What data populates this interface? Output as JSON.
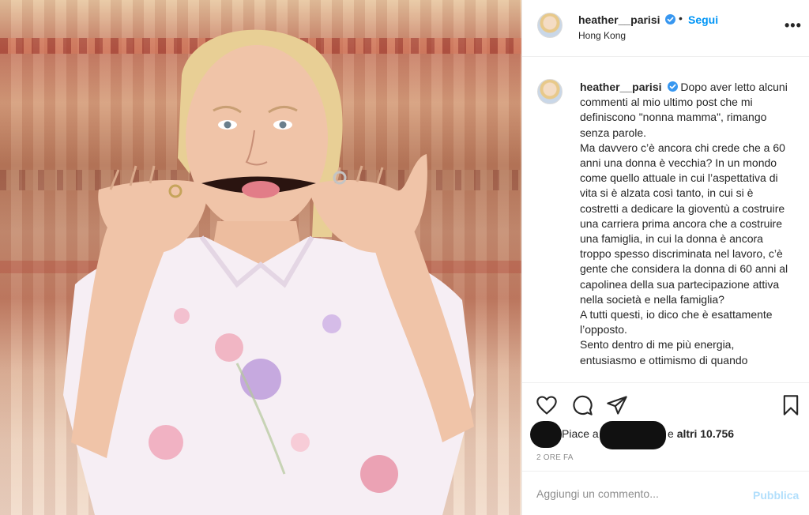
{
  "post": {
    "username": "heather__parisi",
    "verified": true,
    "follow_label": "Segui",
    "separator": "•",
    "location": "Hong Kong",
    "more_icon": "more-options-icon",
    "photo_icon": "post-photo"
  },
  "caption": {
    "username": "heather__parisi",
    "paragraphs": [
      "Dopo aver letto alcuni commenti al mio ultimo post che mi definiscono \"nonna mamma\", rimango senza parole.",
      "Ma davvero c’è ancora chi crede che a 60 anni una donna è vecchia? In un mondo come quello attuale in cui l’aspettativa di vita si è alzata così tanto, in cui si è costretti a dedicare la gioventù a costruire una carriera prima ancora che a costruire una famiglia, in cui la donna è ancora troppo spesso discriminata nel lavoro, c’è gente che considera la donna di 60 anni al capolinea della sua partecipazione attiva nella società e nella famiglia?",
      "A tutti questi, io dico che è esattamente l’opposto.",
      "Sento dentro di me più energia, entusiasmo e ottimismo di quando"
    ]
  },
  "actions": {
    "icons": [
      "heart-icon",
      "comment-icon",
      "share-icon",
      "bookmark-icon"
    ]
  },
  "likes": {
    "prefix": "Piace a",
    "suffix_text": "e",
    "suffix_bold": "altri 10.756"
  },
  "timestamp": "2 ORE FA",
  "comment_box": {
    "placeholder": "Aggiungi un commento...",
    "publish_label": "Pubblica"
  },
  "colors": {
    "accent": "#0095f6",
    "publish_disabled": "#b2dffc",
    "text": "#262626",
    "muted": "#8e8e8e"
  }
}
